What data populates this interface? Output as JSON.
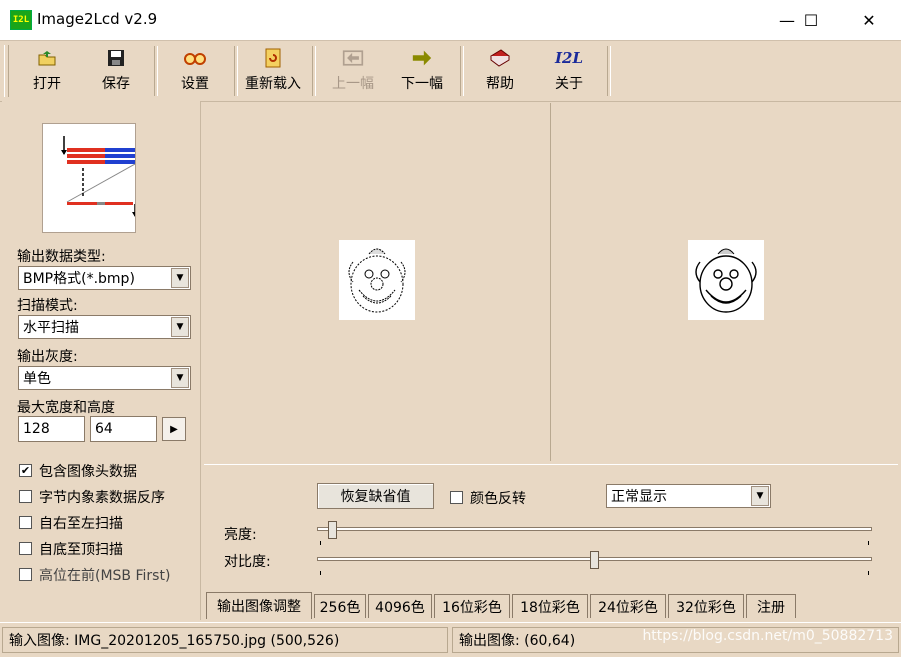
{
  "window": {
    "title": "Image2Lcd v2.9",
    "app_icon_text": "I2L",
    "minimize": "—",
    "maximize": "☐",
    "close": "✕"
  },
  "toolbar": {
    "items": [
      {
        "label": "打开",
        "icon": "open-icon",
        "enabled": true
      },
      {
        "label": "保存",
        "icon": "save-icon",
        "enabled": true
      },
      {
        "label": "设置",
        "icon": "settings-icon",
        "enabled": true
      },
      {
        "label": "重新载入",
        "icon": "reload-icon",
        "enabled": true
      },
      {
        "label": "上一幅",
        "icon": "prev-icon",
        "enabled": false
      },
      {
        "label": "下一幅",
        "icon": "next-icon",
        "enabled": true
      },
      {
        "label": "帮助",
        "icon": "help-icon",
        "enabled": true
      },
      {
        "label": "关于",
        "icon": "about-icon",
        "enabled": true
      }
    ],
    "about_icon_text": "I2L"
  },
  "left_panel": {
    "output_type_label": "输出数据类型:",
    "output_type_value": "BMP格式(*.bmp)",
    "scan_mode_label": "扫描模式:",
    "scan_mode_value": "水平扫描",
    "gray_label": "输出灰度:",
    "gray_value": "单色",
    "max_size_label": "最大宽度和高度",
    "max_width": "128",
    "max_height": "64",
    "options": [
      {
        "label": "包含图像头数据",
        "checked": true
      },
      {
        "label": "字节内象素数据反序",
        "checked": false
      },
      {
        "label": "自右至左扫描",
        "checked": false
      },
      {
        "label": "自底至顶扫描",
        "checked": false
      },
      {
        "label": "高位在前(MSB First)",
        "checked": false
      }
    ]
  },
  "adjust": {
    "restore_button": "恢复缺省值",
    "invert_label": "颜色反转",
    "invert_checked": false,
    "display_mode": "正常显示",
    "brightness_label": "亮度:",
    "brightness_level": 0.02,
    "contrast_label": "对比度:",
    "contrast_level": 0.5
  },
  "tabs": [
    "输出图像调整",
    "256色",
    "4096色",
    "16位彩色",
    "18位彩色",
    "24位彩色",
    "32位彩色",
    "注册"
  ],
  "active_tab": 0,
  "status": {
    "input_image": "输入图像: IMG_20201205_165750.jpg (500,526)",
    "output_image": "输出图像: (60,64)",
    "watermark": "https://blog.csdn.net/m0_50882713"
  }
}
